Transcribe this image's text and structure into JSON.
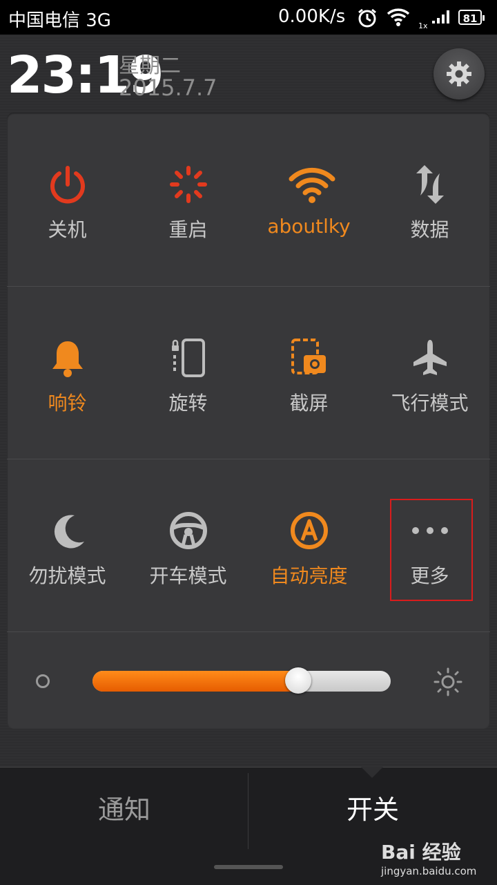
{
  "status_bar": {
    "carrier": "中国电信 3G",
    "net_speed": "0.00K/s",
    "signal_label": "1x",
    "battery": "81",
    "icons": [
      "alarm-icon",
      "wifi-icon",
      "signal-icon",
      "battery-icon"
    ]
  },
  "header": {
    "time": "23:19",
    "weekday": "星期二",
    "date": "2015.7.7"
  },
  "toggles": [
    {
      "label": "关机",
      "icon": "power-icon",
      "active": false
    },
    {
      "label": "重启",
      "icon": "restart-icon",
      "active": false
    },
    {
      "label": "aboutlky",
      "icon": "wifi-icon",
      "active": true
    },
    {
      "label": "数据",
      "icon": "data-transfer-icon",
      "active": false
    },
    {
      "label": "响铃",
      "icon": "bell-icon",
      "active": true
    },
    {
      "label": "旋转",
      "icon": "rotation-lock-icon",
      "active": false
    },
    {
      "label": "截屏",
      "icon": "screenshot-icon",
      "active": false
    },
    {
      "label": "飞行模式",
      "icon": "airplane-icon",
      "active": false
    },
    {
      "label": "勿扰模式",
      "icon": "moon-icon",
      "active": false
    },
    {
      "label": "开车模式",
      "icon": "steering-wheel-icon",
      "active": false
    },
    {
      "label": "自动亮度",
      "icon": "auto-brightness-icon",
      "active": true
    },
    {
      "label": "更多",
      "icon": "more-icon",
      "active": false
    }
  ],
  "brightness": {
    "level": 0.69
  },
  "tabs": {
    "notifications": "通知",
    "toggles": "开关",
    "selected": "开关"
  },
  "colors": {
    "accent": "#f0891e",
    "power_red": "#e23a1e",
    "highlight_box": "#d91c1c"
  },
  "watermark": {
    "logo": "Bai 经验",
    "url": "jingyan.baidu.com"
  }
}
